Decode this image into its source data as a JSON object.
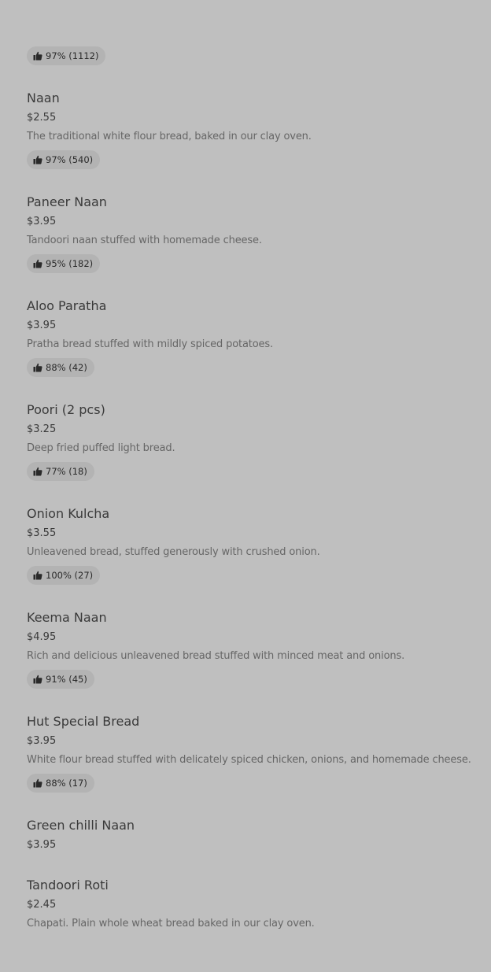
{
  "menu": {
    "items": [
      {
        "name": "",
        "price": "",
        "description": "",
        "rating": "97% (1112)"
      },
      {
        "name": "Naan",
        "price": "$2.55",
        "description": "The traditional white flour bread, baked in our clay oven.",
        "rating": "97% (540)"
      },
      {
        "name": "Paneer Naan",
        "price": "$3.95",
        "description": "Tandoori naan stuffed with homemade cheese.",
        "rating": "95% (182)"
      },
      {
        "name": "Aloo Paratha",
        "price": "$3.95",
        "description": "Pratha bread stuffed with mildly spiced potatoes.",
        "rating": "88% (42)"
      },
      {
        "name": "Poori (2 pcs)",
        "price": "$3.25",
        "description": "Deep fried puffed light bread.",
        "rating": "77% (18)"
      },
      {
        "name": "Onion Kulcha",
        "price": "$3.55",
        "description": "Unleavened bread, stuffed generously with crushed onion.",
        "rating": "100% (27)"
      },
      {
        "name": "Keema Naan",
        "price": "$4.95",
        "description": "Rich and delicious unleavened bread stuffed with minced meat and onions.",
        "rating": "91% (45)"
      },
      {
        "name": "Hut Special Bread",
        "price": "$3.95",
        "description": "White flour bread stuffed with delicately spiced chicken, onions, and homemade cheese.",
        "rating": "88% (17)"
      },
      {
        "name": "Green chilli Naan",
        "price": "$3.95"
      },
      {
        "name": "Tandoori Roti",
        "price": "$2.45",
        "description": "Chapati. Plain whole wheat bread baked in our clay oven."
      }
    ]
  },
  "icons": {
    "rating": "thumbs-up-icon"
  },
  "colors": {
    "background": "#bfbfbf",
    "badge": "#b3b3b3",
    "title_text": "#3a3a3a",
    "description_text": "#666666"
  }
}
